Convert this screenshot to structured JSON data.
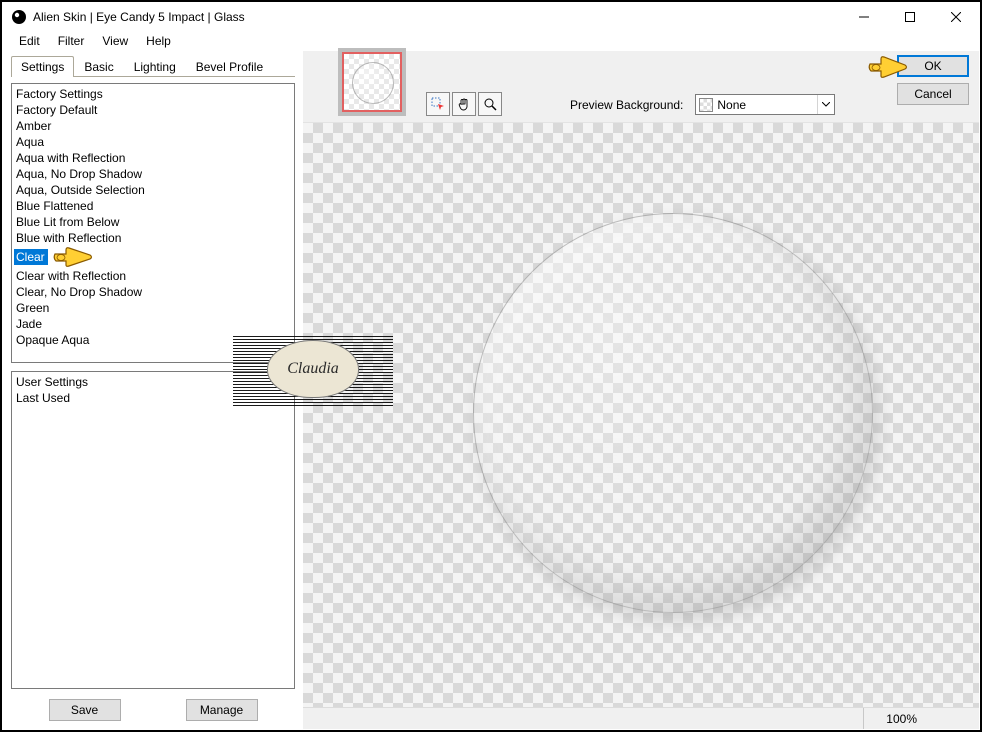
{
  "window": {
    "title": "Alien Skin | Eye Candy 5 Impact | Glass"
  },
  "menu": {
    "edit": "Edit",
    "filter": "Filter",
    "view": "View",
    "help": "Help"
  },
  "tabs": {
    "settings": "Settings",
    "basic": "Basic",
    "lighting": "Lighting",
    "bevel": "Bevel Profile"
  },
  "factory": {
    "header": "Factory Settings",
    "items": [
      "Factory Default",
      "Amber",
      "Aqua",
      "Aqua with Reflection",
      "Aqua, No Drop Shadow",
      "Aqua, Outside Selection",
      "Blue Flattened",
      "Blue Lit from Below",
      "Blue with Reflection",
      "Clear",
      "Clear with Reflection",
      "Clear, No Drop Shadow",
      "Green",
      "Jade",
      "Opaque Aqua"
    ],
    "selected_index": 9
  },
  "user": {
    "header": "User Settings",
    "last_used": "Last Used"
  },
  "buttons": {
    "save": "Save",
    "manage": "Manage",
    "ok": "OK",
    "cancel": "Cancel"
  },
  "preview": {
    "bg_label": "Preview Background:",
    "bg_value": "None"
  },
  "status": {
    "zoom": "100%"
  },
  "watermark": {
    "text": "Claudia"
  }
}
